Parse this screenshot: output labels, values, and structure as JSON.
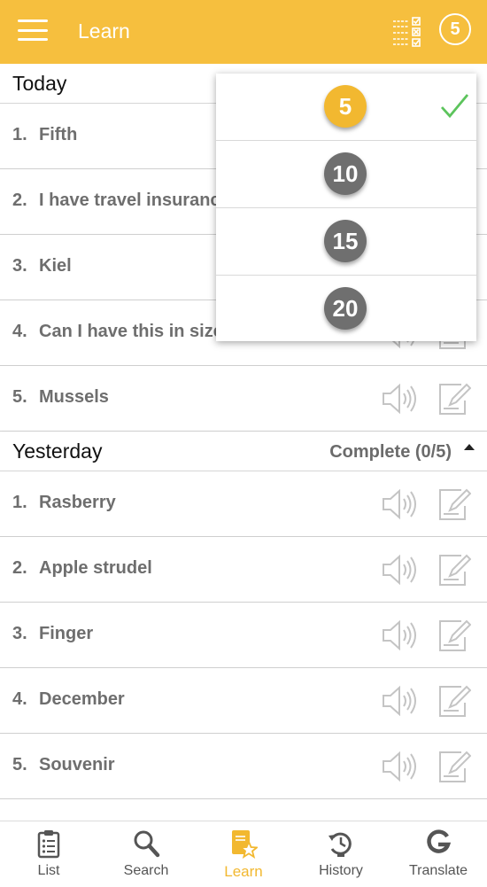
{
  "app_bar": {
    "title": "Learn",
    "badge_count": "5"
  },
  "sections": [
    {
      "title": "Today",
      "items": [
        {
          "num": "1.",
          "text": "Fifth"
        },
        {
          "num": "2.",
          "text": "I have travel insurance."
        },
        {
          "num": "3.",
          "text": "Kiel"
        },
        {
          "num": "4.",
          "text": "Can I have this in size"
        },
        {
          "num": "5.",
          "text": "Mussels"
        }
      ]
    },
    {
      "title": "Yesterday",
      "status": "Complete (0/5)",
      "items": [
        {
          "num": "1.",
          "text": "Rasberry"
        },
        {
          "num": "2.",
          "text": "Apple strudel"
        },
        {
          "num": "3.",
          "text": "Finger"
        },
        {
          "num": "4.",
          "text": "December"
        },
        {
          "num": "5.",
          "text": "Souvenir"
        }
      ]
    }
  ],
  "dropdown": {
    "options": [
      "5",
      "10",
      "15",
      "20"
    ],
    "selected": "5"
  },
  "bottom_nav": [
    {
      "label": "List",
      "icon": "list-icon"
    },
    {
      "label": "Search",
      "icon": "search-icon"
    },
    {
      "label": "Learn",
      "icon": "learn-icon",
      "active": true
    },
    {
      "label": "History",
      "icon": "history-icon"
    },
    {
      "label": "Translate",
      "icon": "translate-icon"
    }
  ],
  "colors": {
    "accent": "#f6bf3e",
    "selected_option": "#f2b830",
    "option": "#6f6f6f",
    "check": "#5cc45c",
    "text_gray": "#6e6e6e"
  }
}
